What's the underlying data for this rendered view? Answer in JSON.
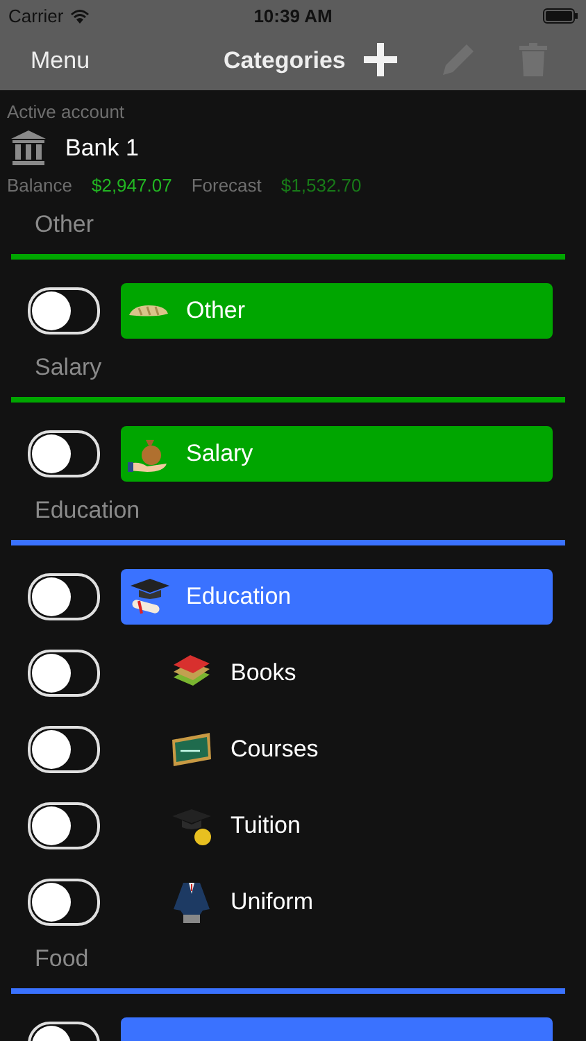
{
  "status_bar": {
    "carrier": "Carrier",
    "time": "10:39 AM"
  },
  "nav": {
    "menu": "Menu",
    "title": "Categories",
    "actions": [
      {
        "kind": "add",
        "disabled": false
      },
      {
        "kind": "edit",
        "disabled": true
      },
      {
        "kind": "delete",
        "disabled": true
      }
    ]
  },
  "account": {
    "caption": "Active account",
    "name": "Bank 1",
    "balance_label": "Balance",
    "balance": "$2,947.07",
    "forecast_label": "Forecast",
    "forecast": "$1,532.70"
  },
  "sections": [
    {
      "title": "Other",
      "color": "#00a600",
      "categories": [
        {
          "name": "Other",
          "kind": "bread",
          "on": false
        }
      ]
    },
    {
      "title": "Salary",
      "color": "#00a600",
      "categories": [
        {
          "name": "Salary",
          "kind": "money",
          "on": false
        }
      ]
    },
    {
      "title": "Education",
      "color": "#3a72ff",
      "categories": [
        {
          "name": "Education",
          "kind": "graduation",
          "on": false,
          "children": [
            {
              "name": "Books",
              "kind": "books",
              "on": false
            },
            {
              "name": "Courses",
              "kind": "chalkboard",
              "on": false
            },
            {
              "name": "Tuition",
              "kind": "capcoin",
              "on": false
            },
            {
              "name": "Uniform",
              "kind": "jacket",
              "on": false
            }
          ]
        }
      ]
    },
    {
      "title": "Food",
      "color": "#3a72ff",
      "categories": [
        {
          "on": false
        }
      ]
    }
  ]
}
